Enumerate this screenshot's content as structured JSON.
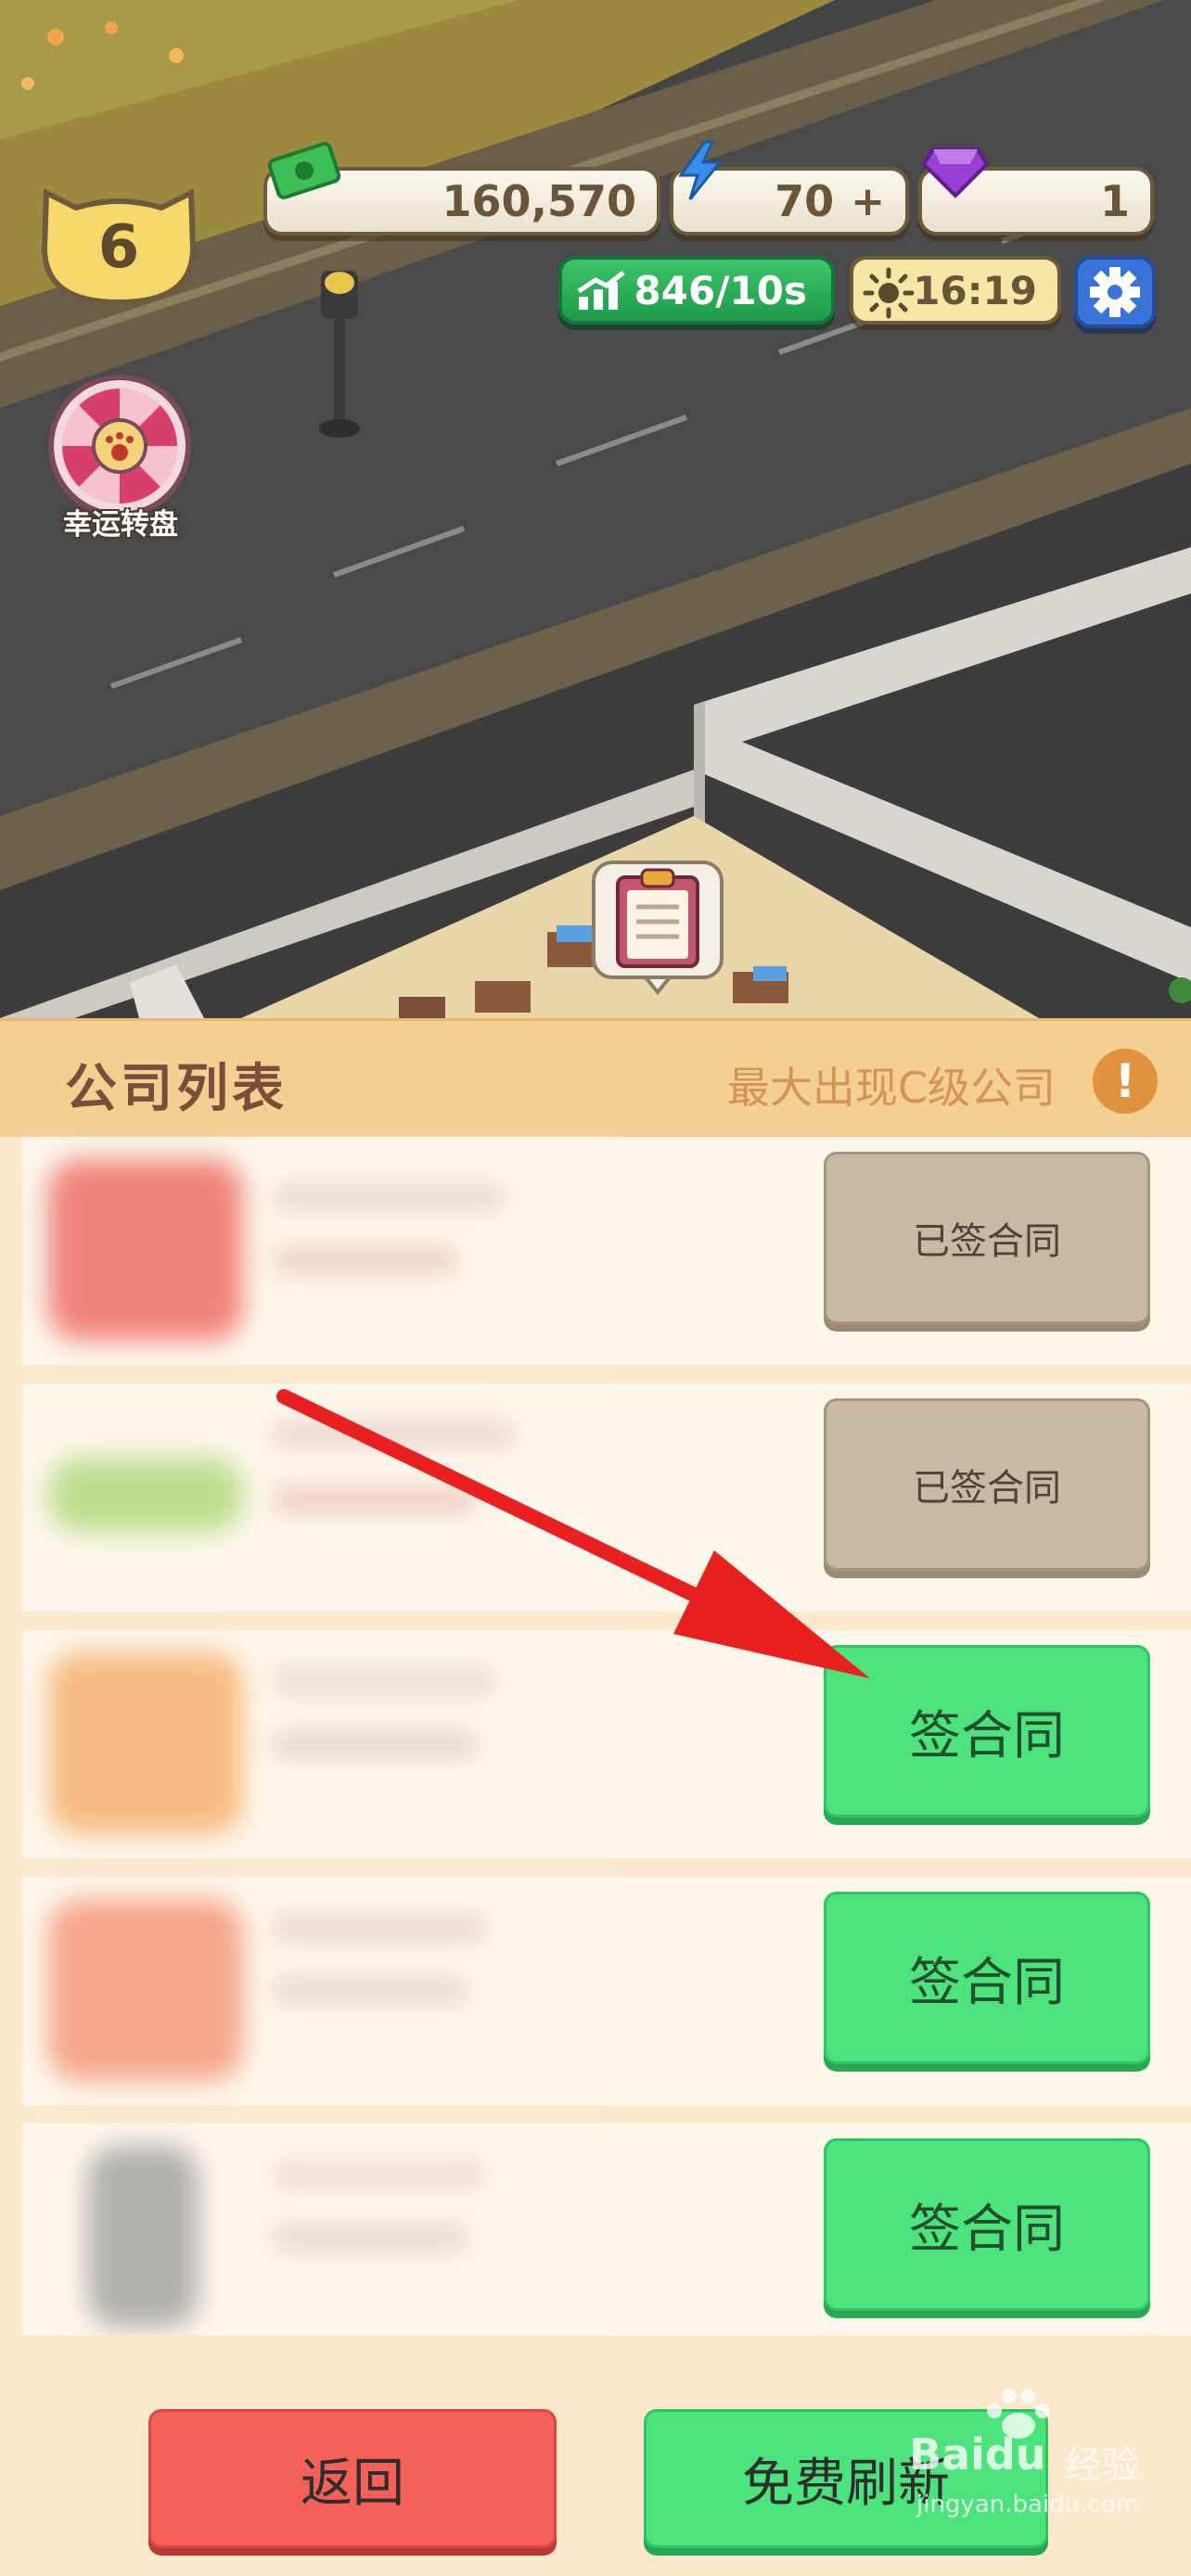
{
  "hud": {
    "cash": "160,570",
    "energy": "70",
    "energy_add": "+",
    "gems": "1",
    "level": "6",
    "income_rate": "846/10s",
    "clock": "16:19"
  },
  "lucky_wheel": {
    "label": "幸运转盘"
  },
  "panel": {
    "title": "公司列表",
    "hint": "最大出现C级公司",
    "info_symbol": "!"
  },
  "companies": [
    {
      "button_label": "已签合同",
      "status": "signed",
      "logo_color": "#e8453c"
    },
    {
      "button_label": "已签合同",
      "status": "signed",
      "logo_color": "#9ad05a"
    },
    {
      "button_label": "签合同",
      "status": "available",
      "logo_color": "#f39a45"
    },
    {
      "button_label": "签合同",
      "status": "available",
      "logo_color": "#f07a55"
    },
    {
      "button_label": "签合同",
      "status": "available",
      "logo_color": "#8a8a8a"
    }
  ],
  "footer": {
    "back_label": "返回",
    "refresh_label": "免费刷新"
  },
  "watermark": {
    "brand": "Baidu",
    "brand_cn": "经验",
    "url": "jingyan.baidu.com"
  },
  "colors": {
    "panel_header": "#f3cf91",
    "signed_button": "#c9b9a3",
    "sign_button": "#4de37c",
    "back_button": "#f56058",
    "annotation_arrow": "#e8201f"
  }
}
